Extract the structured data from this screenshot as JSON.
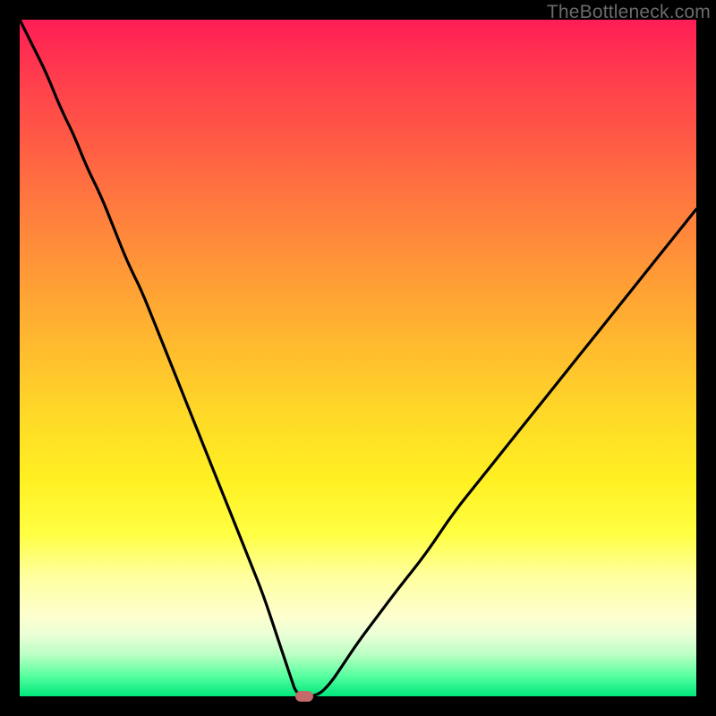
{
  "watermark": "TheBottleneck.com",
  "chart_data": {
    "type": "line",
    "title": "",
    "xlabel": "",
    "ylabel": "",
    "xlim": [
      0,
      100
    ],
    "ylim": [
      0,
      100
    ],
    "grid": false,
    "legend": false,
    "background_gradient": {
      "direction": "vertical",
      "stops": [
        {
          "pct": 0,
          "color": "#ff1d56"
        },
        {
          "pct": 18,
          "color": "#ff5b45"
        },
        {
          "pct": 38,
          "color": "#ff9b36"
        },
        {
          "pct": 58,
          "color": "#ffd828"
        },
        {
          "pct": 76,
          "color": "#ffff42"
        },
        {
          "pct": 88,
          "color": "#feffce"
        },
        {
          "pct": 94,
          "color": "#b7ffc2"
        },
        {
          "pct": 100,
          "color": "#00e77c"
        }
      ]
    },
    "series": [
      {
        "name": "bottleneck-curve",
        "color": "#000000",
        "x": [
          0,
          2,
          4,
          6,
          8,
          10,
          12,
          14,
          16,
          18,
          20,
          22,
          24,
          26,
          28,
          30,
          32,
          34,
          36,
          38,
          40,
          41,
          44,
          46,
          48,
          50,
          53,
          56,
          60,
          64,
          68,
          72,
          76,
          80,
          84,
          88,
          92,
          96,
          100
        ],
        "y": [
          100,
          96,
          92,
          87,
          83,
          78,
          74,
          69,
          64,
          60,
          55,
          50,
          45,
          40,
          35,
          30,
          25,
          20,
          15,
          9,
          3,
          0,
          0,
          2,
          5,
          8,
          12,
          16,
          21,
          27,
          32,
          37,
          42,
          47,
          52,
          57,
          62,
          67,
          72
        ]
      }
    ],
    "marker": {
      "name": "optimal-point",
      "x": 42,
      "y": 0,
      "color": "#c46a6a",
      "shape": "rounded-rect"
    }
  }
}
